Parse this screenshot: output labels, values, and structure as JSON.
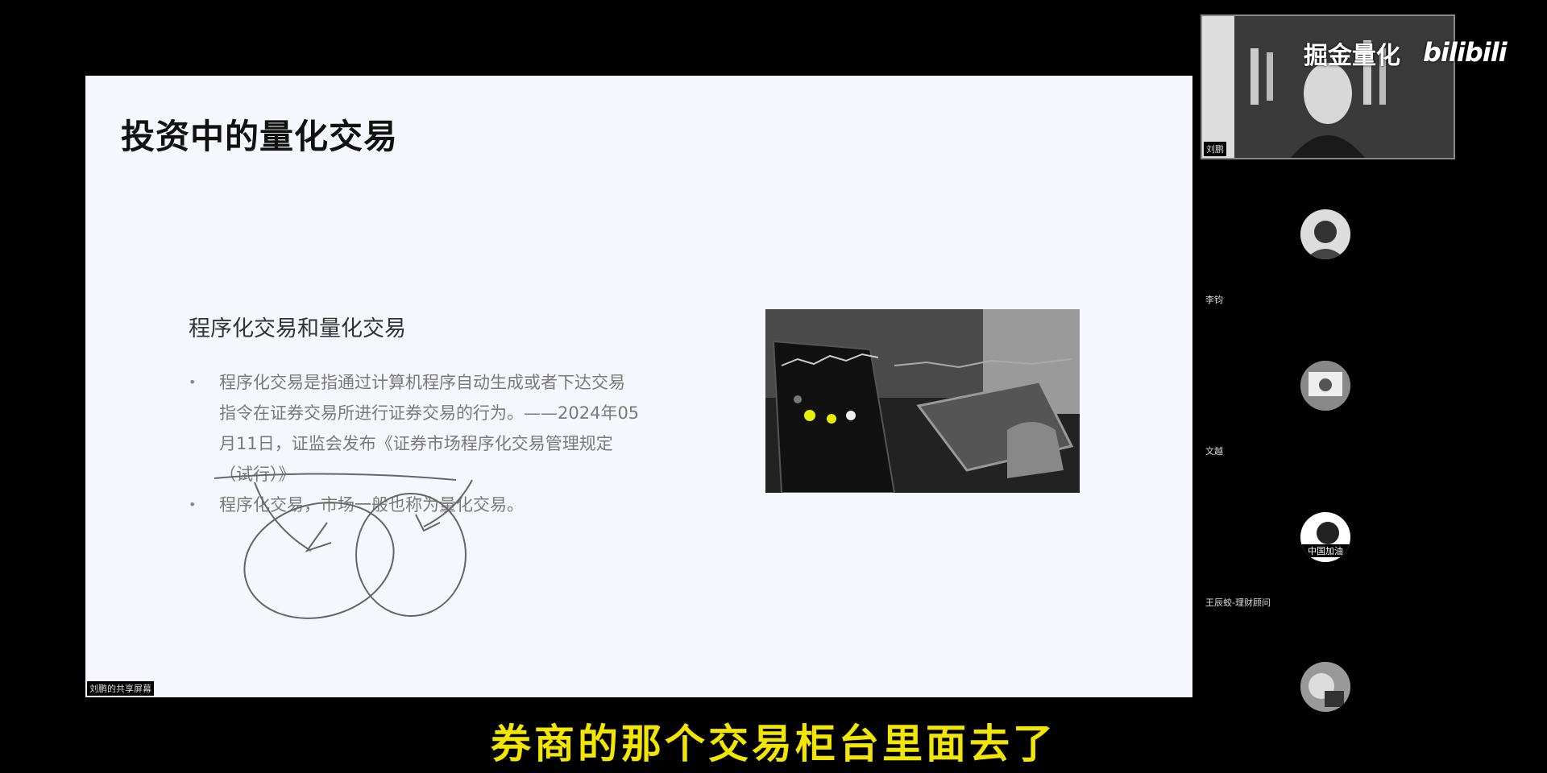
{
  "slide": {
    "title": "投资中的量化交易",
    "sub_heading": "程序化交易和量化交易",
    "bullets": [
      "程序化交易是指通过计算机程序自动生成或者下达交易指令在证券交易所进行证券交易的行为。——2024年05月11日，证监会发布《证券市场程序化交易管理规定（试行）》",
      "程序化交易，市场一般也称为量化交易。"
    ],
    "sharer_label": "刘鹏的共享屏幕"
  },
  "camera": {
    "name": "刘鹏",
    "watermark": "掘金量化",
    "platform_logo": "bilibili"
  },
  "participants": [
    {
      "name": "李钧",
      "avatar_icon": "avatar-image"
    },
    {
      "name": "文越",
      "avatar_icon": "avatar-image"
    },
    {
      "name": "王辰蛟-理财顾问",
      "avatar_icon": "avatar-image",
      "avatar_text": "中国加油"
    },
    {
      "name": "",
      "avatar_icon": "avatar-image"
    }
  ],
  "subtitle": "券商的那个交易柜台里面去了",
  "colors": {
    "background": "#000000",
    "slide_bg": "#f6f7fc",
    "subtitle": "#f2e600",
    "highlight_dot": "#e8f000"
  }
}
